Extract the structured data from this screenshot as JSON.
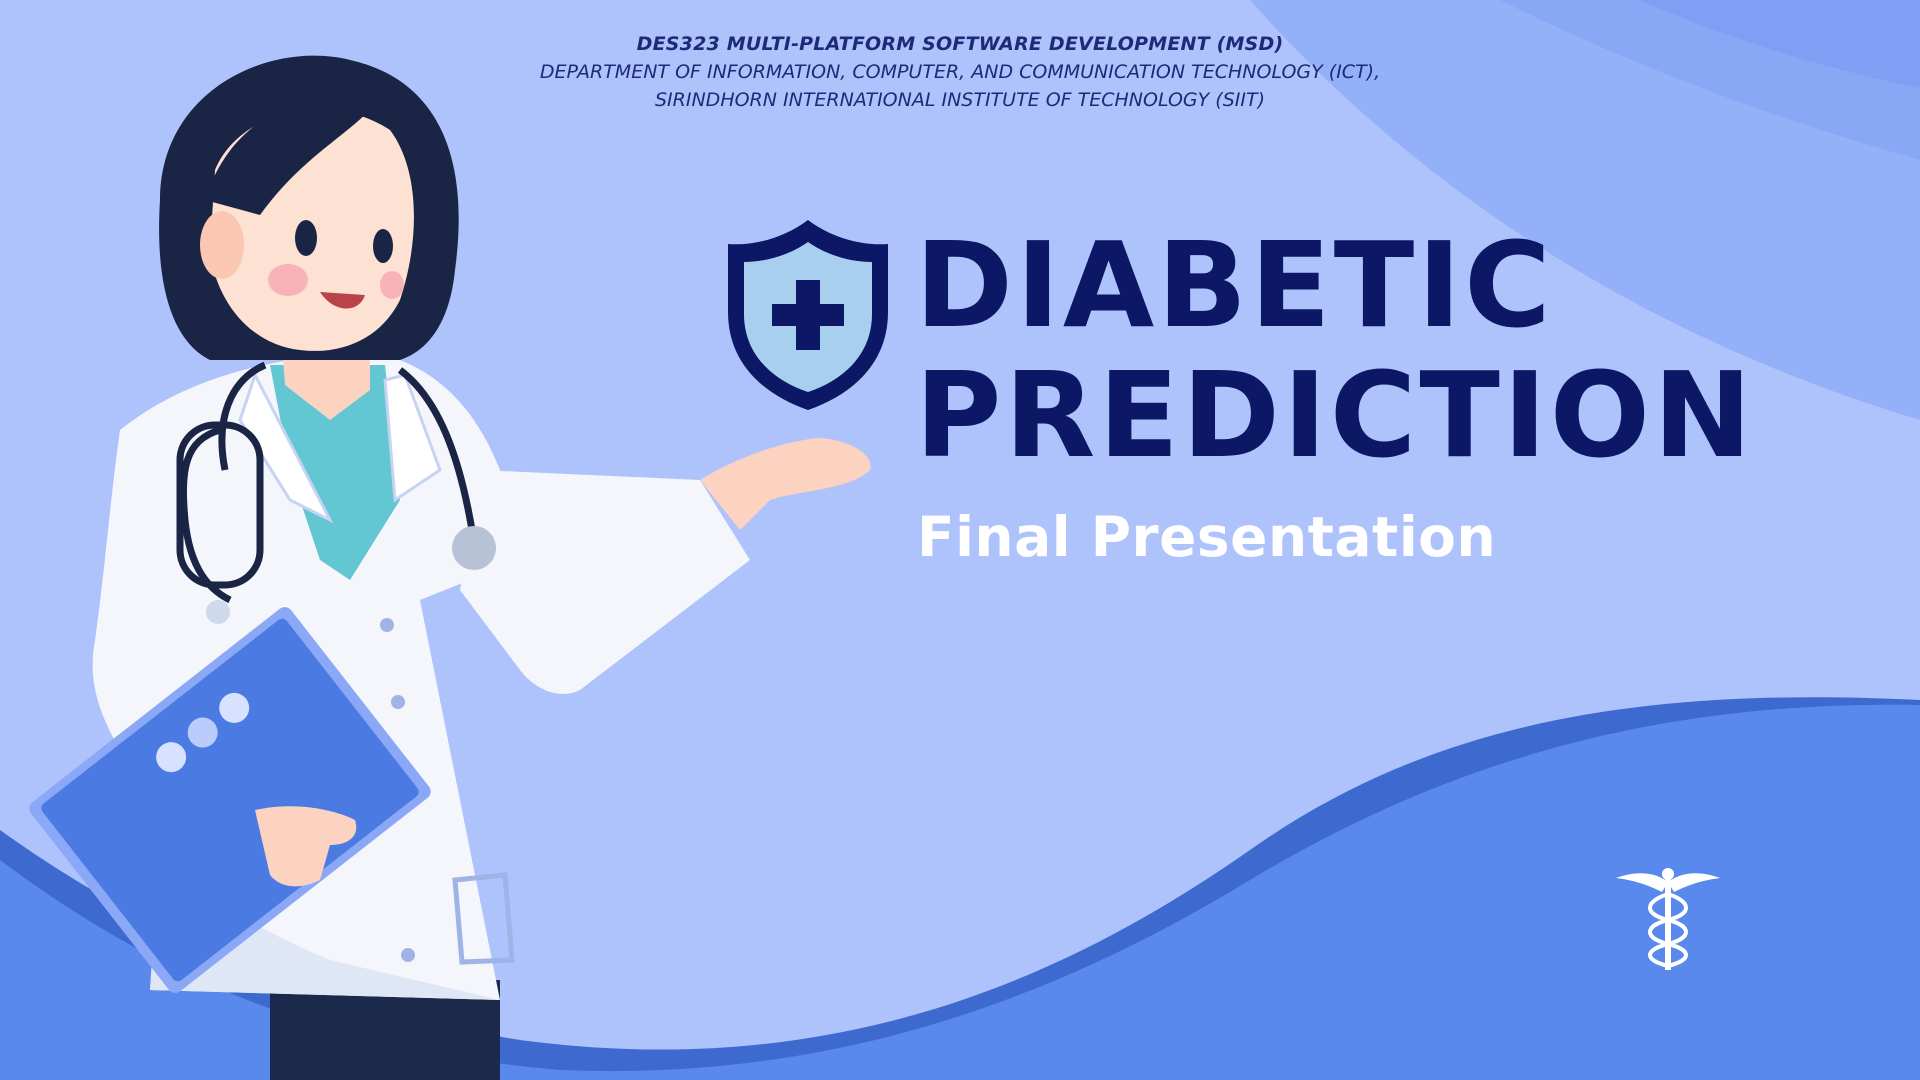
{
  "header": {
    "course": "DES323 MULTI-PLATFORM SOFTWARE DEVELOPMENT (MSD)",
    "department": "DEPARTMENT OF INFORMATION, COMPUTER, AND COMMUNICATION TECHNOLOGY (ICT),",
    "institute": "SIRINDHORN INTERNATIONAL INSTITUTE OF TECHNOLOGY (SIIT)"
  },
  "title": {
    "line1": "DIABETIC",
    "line2": "PREDICTION"
  },
  "subtitle": "Final Presentation",
  "icons": {
    "shield": "shield-plus-icon",
    "caduceus": "caduceus-icon"
  },
  "colors": {
    "background": "#aec2fc",
    "wave_dark": "#3e6ad0",
    "wave_light": "#5a89ee",
    "title": "#0c1766",
    "subtitle": "#ffffff",
    "header": "#1e2a78"
  }
}
